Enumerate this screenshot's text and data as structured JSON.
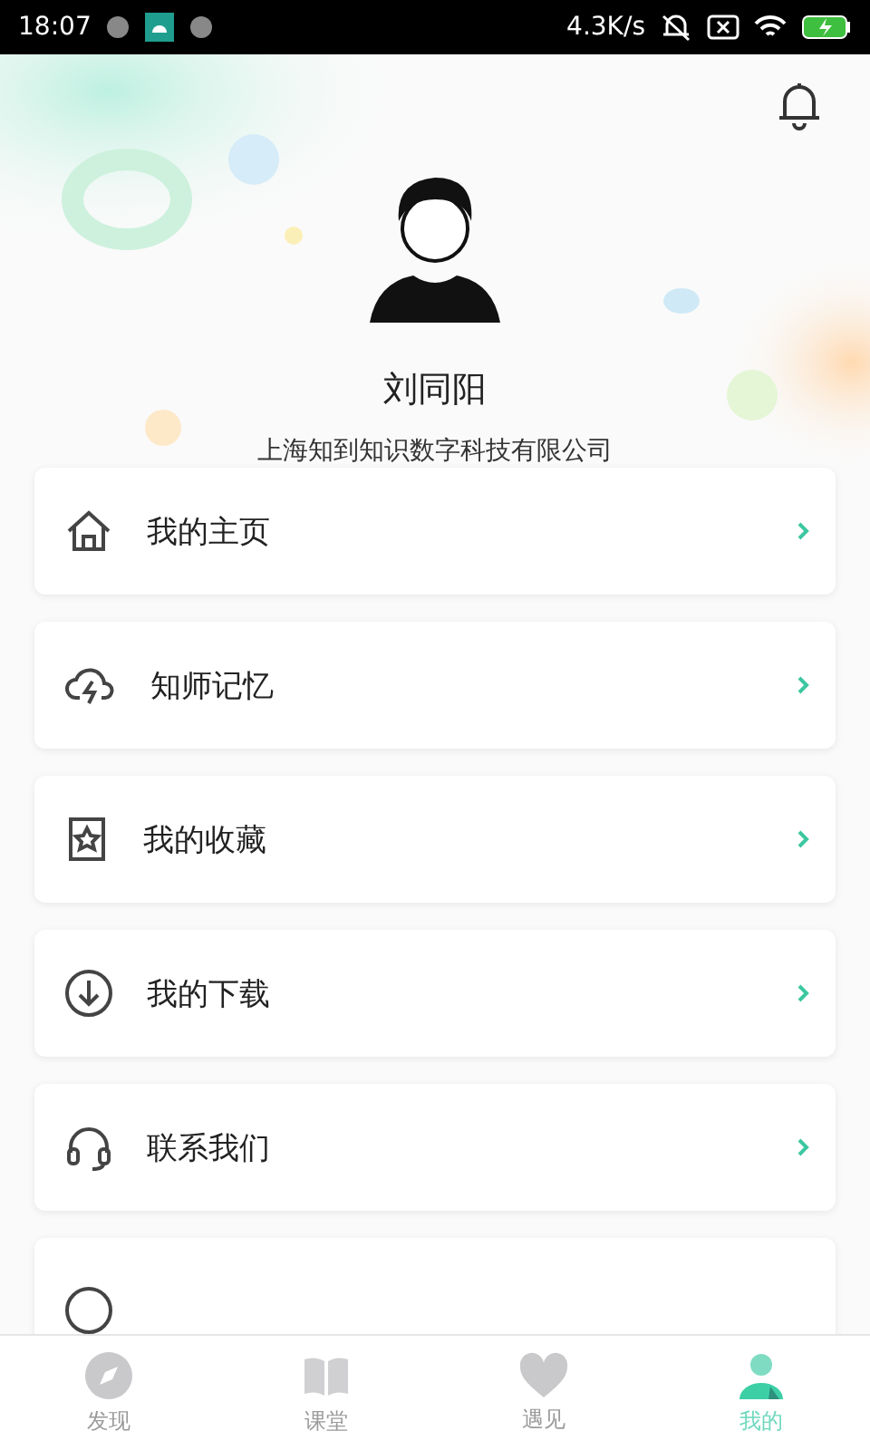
{
  "status_bar": {
    "time": "18:07",
    "speed": "4.3K/s"
  },
  "profile": {
    "name": "刘同阳",
    "company": "上海知到知识数字科技有限公司"
  },
  "menu": [
    {
      "label": "我的主页"
    },
    {
      "label": "知师记忆"
    },
    {
      "label": "我的收藏"
    },
    {
      "label": "我的下载"
    },
    {
      "label": "联系我们"
    }
  ],
  "menu_more_visible": true,
  "tabs": [
    {
      "label": "发现",
      "selected": false
    },
    {
      "label": "课堂",
      "selected": false
    },
    {
      "label": "遇见",
      "selected": false
    },
    {
      "label": "我的",
      "selected": true
    }
  ]
}
